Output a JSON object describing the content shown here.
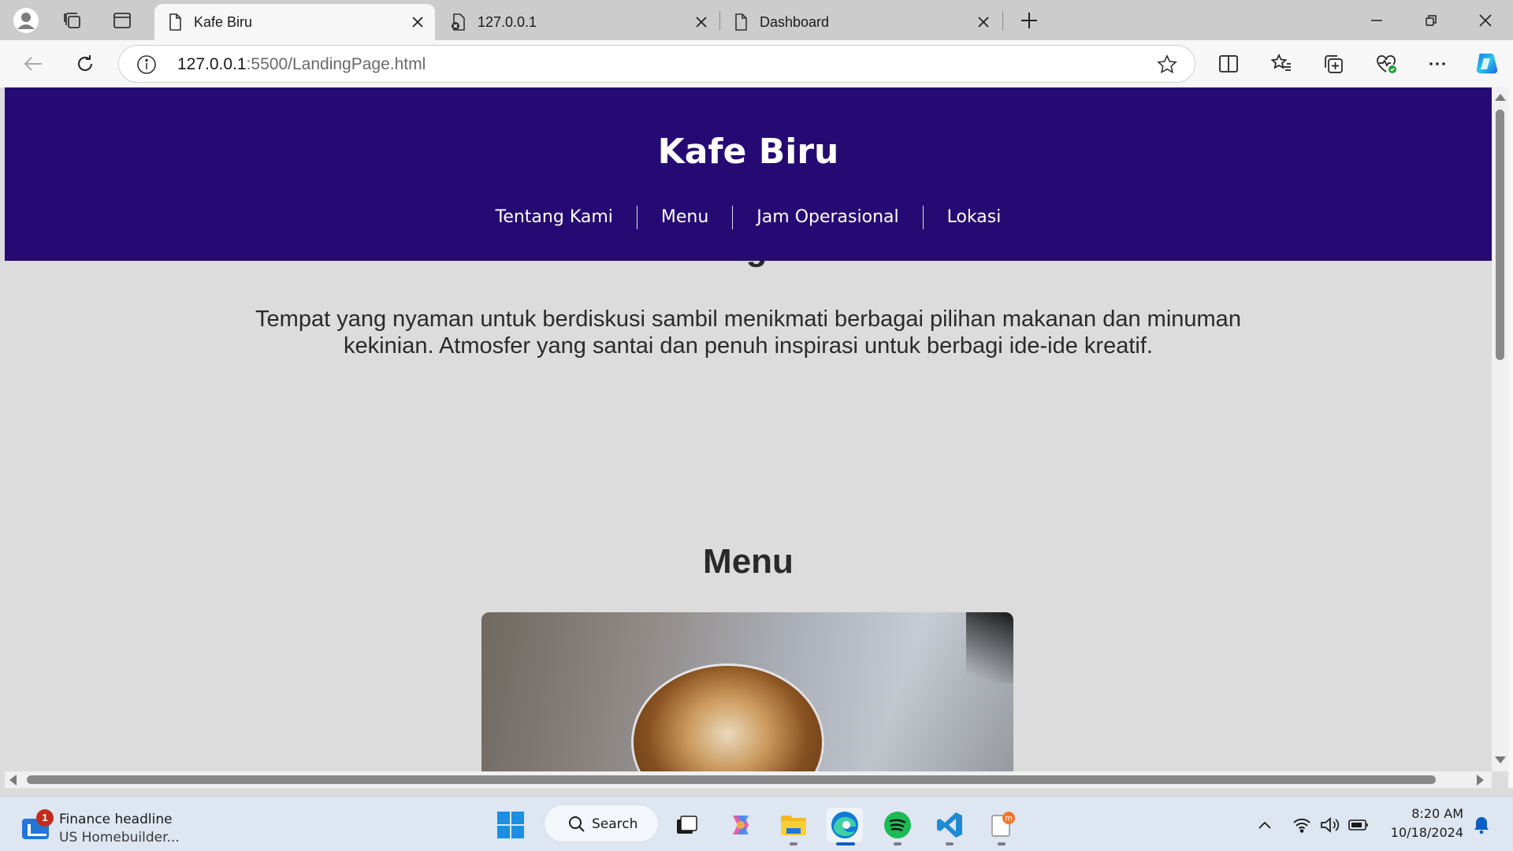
{
  "browser": {
    "tabs": [
      {
        "title": "Kafe Biru",
        "active": true,
        "icon": "page-icon"
      },
      {
        "title": "127.0.0.1",
        "active": false,
        "icon": "error-page-icon"
      },
      {
        "title": "Dashboard",
        "active": false,
        "icon": "page-icon"
      }
    ],
    "address": {
      "host": "127.0.0.1",
      "path": ":5500/LandingPage.html"
    }
  },
  "site": {
    "title": "Kafe Biru",
    "nav": [
      "Tentang Kami",
      "Menu",
      "Jam Operasional",
      "Lokasi"
    ],
    "about_heading": "Tentang Kami",
    "about_text": "Tempat yang nyaman untuk berdiskusi sambil menikmati berbagai pilihan makanan dan minuman kekinian. Atmosfer yang santai dan penuh inspirasi untuk berbagi ide-ide kreatif.",
    "menu_heading": "Menu",
    "header_color": "#260a74"
  },
  "taskbar": {
    "widget": {
      "badge": "1",
      "headline": "Finance headline",
      "subtitle": "US Homebuilder..."
    },
    "search_label": "Search",
    "clock": {
      "time": "8:20 AM",
      "date": "10/18/2024"
    }
  }
}
